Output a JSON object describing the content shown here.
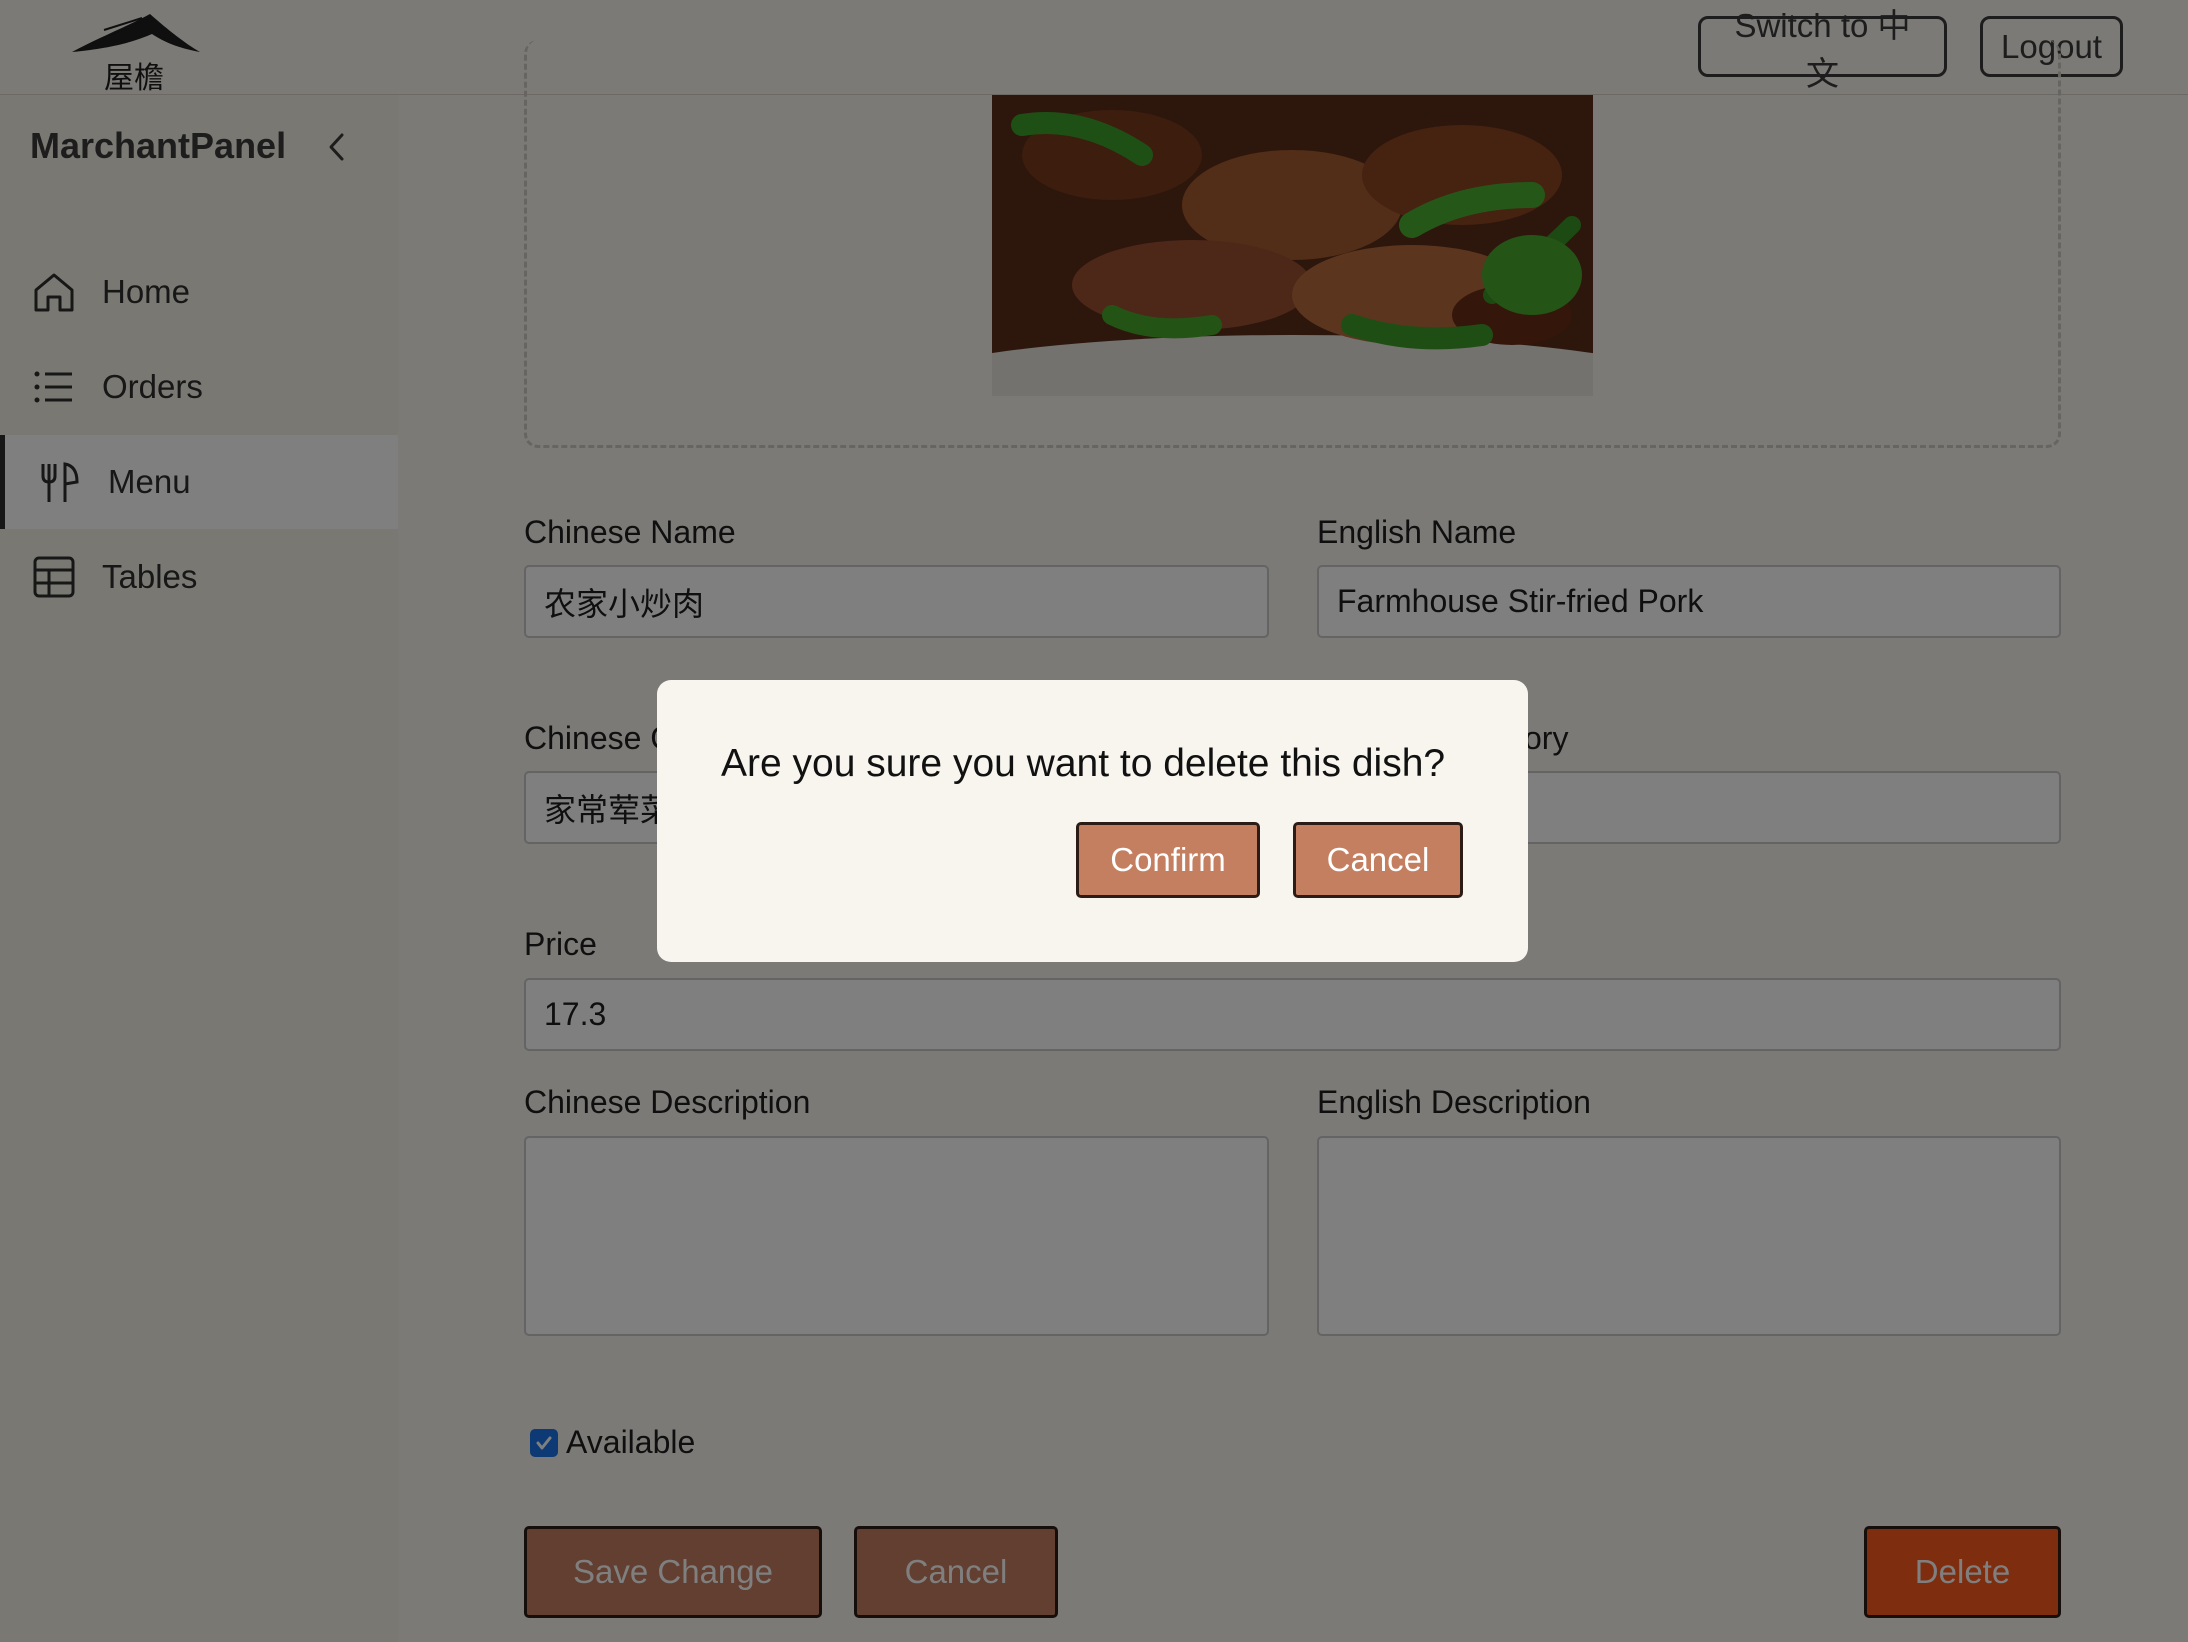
{
  "header": {
    "logo_icon": "restaurant-roof-logo",
    "lang_button": "Switch to 中文",
    "logout_button": "Logout"
  },
  "sidebar": {
    "title": "MarchantPanel",
    "collapse_icon": "chevron-left-icon",
    "items": [
      {
        "label": "Home",
        "icon": "home-icon",
        "active": false
      },
      {
        "label": "Orders",
        "icon": "list-icon",
        "active": false
      },
      {
        "label": "Menu",
        "icon": "utensils-icon",
        "active": true
      },
      {
        "label": "Tables",
        "icon": "table-grid-icon",
        "active": false
      }
    ]
  },
  "form": {
    "chinese_name_label": "Chinese Name",
    "chinese_name_value": "农家小炒肉",
    "english_name_label": "English Name",
    "english_name_value": "Farmhouse Stir-fried Pork",
    "chinese_category_label": "Chinese C",
    "chinese_category_value": "家常荤菜",
    "english_category_label": "ory",
    "price_label": "Price",
    "price_value": "17.3",
    "chinese_desc_label": "Chinese Description",
    "english_desc_label": "English Description",
    "available_label": "Available",
    "available_checked": true,
    "save_button": "Save Change",
    "cancel_button": "Cancel",
    "delete_button": "Delete"
  },
  "modal": {
    "message": "Are you sure you want to delete this dish?",
    "confirm_button": "Confirm",
    "cancel_button": "Cancel"
  },
  "colors": {
    "button_brown": "#c47f60",
    "delete_orange": "#fd5a1f",
    "background": "#f8f5ef",
    "checkbox_blue": "#1a73e8"
  }
}
